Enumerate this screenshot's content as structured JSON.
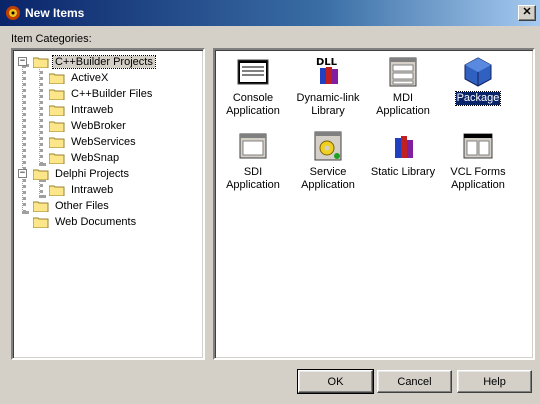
{
  "window": {
    "title": "New Items",
    "close_glyph": "✕"
  },
  "tree": {
    "label": "Item Categories:",
    "nodes": [
      {
        "label": "C++Builder Projects"
      },
      {
        "label": "ActiveX"
      },
      {
        "label": "C++Builder Files"
      },
      {
        "label": "Intraweb"
      },
      {
        "label": "WebBroker"
      },
      {
        "label": "WebServices"
      },
      {
        "label": "WebSnap"
      },
      {
        "label": "Delphi Projects"
      },
      {
        "label": "Intraweb"
      },
      {
        "label": "Other Files"
      },
      {
        "label": "Web Documents"
      }
    ]
  },
  "items": [
    {
      "label": "Console\nApplication",
      "icon": "console-icon"
    },
    {
      "label": "Dynamic-link\nLibrary",
      "icon": "dll-icon"
    },
    {
      "label": "MDI\nApplication",
      "icon": "mdi-icon"
    },
    {
      "label": "Package",
      "icon": "package-icon",
      "selected": true
    },
    {
      "label": "SDI\nApplication",
      "icon": "sdi-icon"
    },
    {
      "label": "Service\nApplication",
      "icon": "service-icon"
    },
    {
      "label": "Static Library",
      "icon": "static-library-icon"
    },
    {
      "label": "VCL Forms\nApplication",
      "icon": "vcl-forms-icon"
    }
  ],
  "buttons": {
    "ok": "OK",
    "cancel": "Cancel",
    "help": "Help"
  },
  "colors": {
    "titlebar": "#0a246a",
    "face": "#d4d0c8",
    "selection": "#0a246a"
  }
}
